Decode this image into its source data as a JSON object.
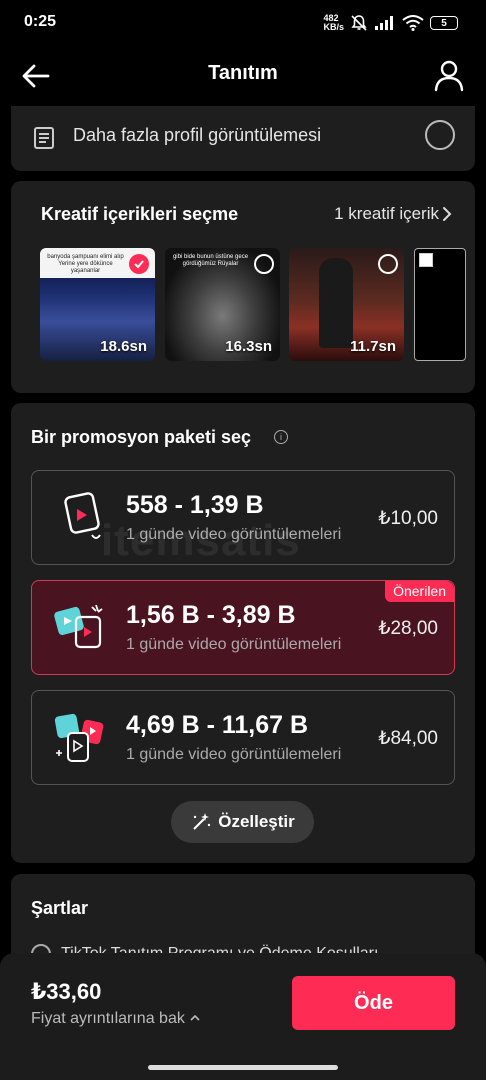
{
  "status_bar": {
    "time": "0:25",
    "net_speed_value": "482",
    "net_speed_unit": "KB/s",
    "battery": "5"
  },
  "header": {
    "title": "Tanıtım"
  },
  "goal_option": {
    "label": "Daha fazla profil görüntülemesi",
    "selected": false
  },
  "creative": {
    "title": "Kreatif içerikleri seçme",
    "count_label": "1 kreatif içerik",
    "thumbnails": [
      {
        "duration": "18.6sn",
        "selected": true,
        "caption": "banyoda şampuanı elimi alıp Yerine yere dökünce yaşananlar"
      },
      {
        "duration": "16.3sn",
        "selected": false,
        "caption": "gibi bide bunun üstüne gece gördüğümüz Rüyalar"
      },
      {
        "duration": "11.7sn",
        "selected": false,
        "caption": ""
      }
    ]
  },
  "package_section": {
    "title": "Bir promosyon paketi seç",
    "watermark": "itemsatis",
    "packages": [
      {
        "range": "558 - 1,39 B",
        "description": "1 günde video görüntülemeleri",
        "price": "₺10,00",
        "badge": "",
        "selected": false
      },
      {
        "range": "1,56 B - 3,89 B",
        "description": "1 günde video görüntülemeleri",
        "price": "₺28,00",
        "badge": "Önerilen",
        "selected": true
      },
      {
        "range": "4,69 B - 11,67 B",
        "description": "1 günde video görüntülemeleri",
        "price": "₺84,00",
        "badge": "",
        "selected": false
      }
    ],
    "customize_label": "Özelleştir"
  },
  "terms": {
    "title": "Şartlar",
    "item_label": "TikTok Tanıtım Programı ve Ödeme Koşulları"
  },
  "footer": {
    "total_price": "₺33,60",
    "price_details_label": "Fiyat ayrıntılarına bak",
    "pay_label": "Öde"
  },
  "colors": {
    "accent": "#fe2c55",
    "selected_bg": "#4a1320",
    "card_bg": "#1e1e1e",
    "icon_cyan": "#5fd4d8"
  }
}
